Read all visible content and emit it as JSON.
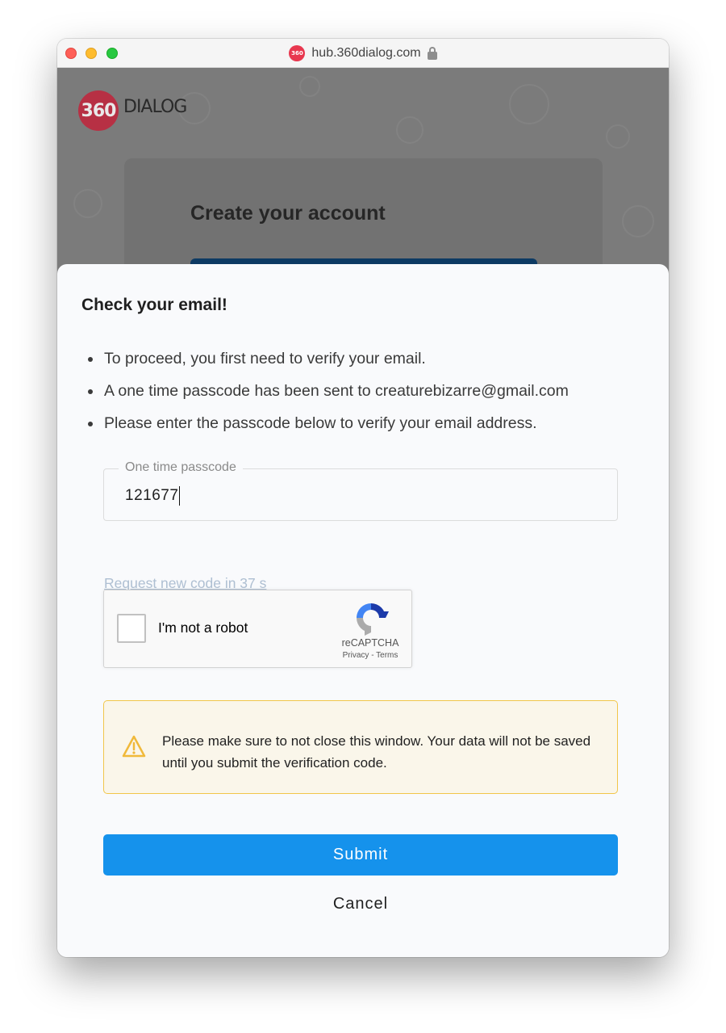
{
  "browser": {
    "favicon_text": "360",
    "url": "hub.360dialog.com"
  },
  "background_page": {
    "logo_number": "360",
    "logo_word": "DIALOG",
    "card_title": "Create your account"
  },
  "modal": {
    "title": "Check your email!",
    "bullets": [
      "To proceed, you first need to verify your email.",
      "A one time passcode has been sent to creaturebizarre@gmail.com",
      "Please enter the passcode below to verify your email address."
    ],
    "passcode": {
      "label": "One time passcode",
      "value": "121677"
    },
    "resend_text": "Request new code in 37 s",
    "captcha": {
      "label": "I'm not a robot",
      "brand": "reCAPTCHA",
      "links": "Privacy - Terms"
    },
    "warning": {
      "text": "Please make sure to not close this window. Your data will not be saved until you submit the verification code."
    },
    "submit_label": "Submit",
    "cancel_label": "Cancel"
  },
  "colors": {
    "primary": "#1592ec",
    "warning_border": "#f1c64a",
    "warning_bg": "#faf6ea",
    "brand_red": "#e8384f"
  }
}
